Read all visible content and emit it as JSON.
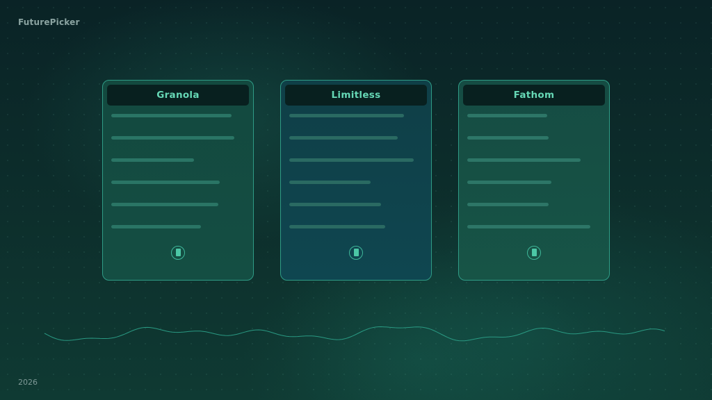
{
  "brand": "FuturePicker",
  "footer_year": "2026",
  "cards": [
    {
      "title": "Granola",
      "icon": "card-icon",
      "lines": [
        0.9,
        0.92,
        0.62,
        0.81,
        0.8,
        0.67
      ]
    },
    {
      "title": "Limitless",
      "icon": "card-icon",
      "lines": [
        0.86,
        0.81,
        0.93,
        0.61,
        0.69,
        0.72
      ]
    },
    {
      "title": "Fathom",
      "icon": "card-icon",
      "lines": [
        0.6,
        0.61,
        0.85,
        0.63,
        0.61,
        0.92
      ]
    }
  ],
  "colors": {
    "accent": "#66d8b6",
    "card_border": "#2f9c86",
    "wave": "#2a9a83"
  }
}
